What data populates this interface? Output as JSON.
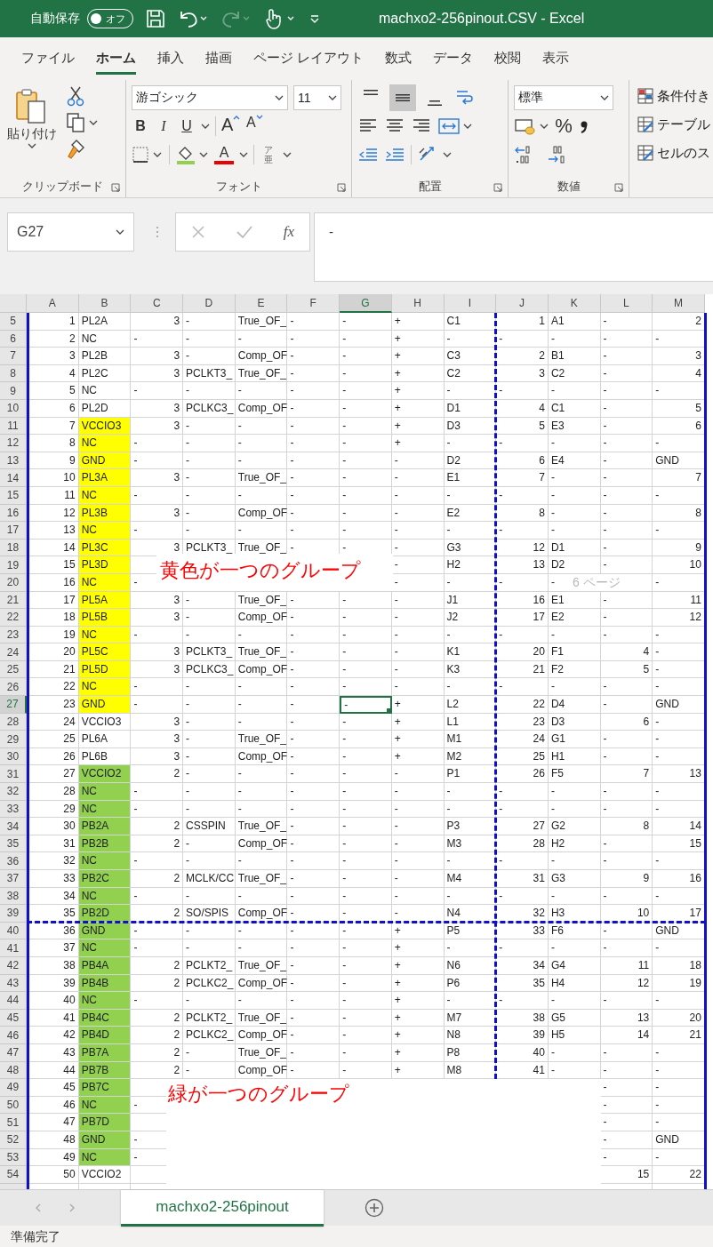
{
  "window": {
    "title": "machxo2-256pinout.CSV  -  Excel",
    "autosave": {
      "label": "自動保存",
      "state_text": "オフ",
      "on": false
    },
    "quick_access": [
      {
        "kind": "save",
        "disabled": false
      },
      {
        "kind": "undo",
        "disabled": false
      },
      {
        "kind": "redo",
        "disabled": true
      },
      {
        "kind": "touch",
        "disabled": false
      },
      {
        "kind": "customize",
        "disabled": false
      }
    ]
  },
  "ribbon_tabs": [
    {
      "label": "ファイル",
      "selected": false
    },
    {
      "label": "ホーム",
      "selected": true
    },
    {
      "label": "挿入",
      "selected": false
    },
    {
      "label": "描画",
      "selected": false
    },
    {
      "label": "ページ レイアウト",
      "selected": false
    },
    {
      "label": "数式",
      "selected": false
    },
    {
      "label": "データ",
      "selected": false
    },
    {
      "label": "校閲",
      "selected": false
    },
    {
      "label": "表示",
      "selected": false
    }
  ],
  "ribbon": {
    "clipboard": {
      "paste": "貼り付け",
      "label": "クリップボード"
    },
    "font": {
      "name": "游ゴシック",
      "size": "11",
      "bold": "B",
      "italic": "I",
      "underline": "U",
      "grow": "A",
      "shrink": "A",
      "font_color": "A",
      "phonetic_top": "ア",
      "phonetic_bottom": "亜",
      "label": "フォント"
    },
    "alignment": {
      "vertical": [
        {
          "kind": "top",
          "selected": false
        },
        {
          "kind": "middle",
          "selected": true
        },
        {
          "kind": "bottom",
          "selected": false
        }
      ],
      "label": "配置"
    },
    "number": {
      "format": "標準",
      "percent": "%",
      "label": "数値"
    },
    "styles": [
      "条件付き",
      "テーブル",
      "セルのス"
    ]
  },
  "formula_bar": {
    "name_box": "G27",
    "fx": "fx",
    "value": "-"
  },
  "sheet": {
    "columns": [
      {
        "label": "A",
        "selected": false
      },
      {
        "label": "B",
        "selected": false
      },
      {
        "label": "C",
        "selected": false
      },
      {
        "label": "D",
        "selected": false
      },
      {
        "label": "E",
        "selected": false
      },
      {
        "label": "F",
        "selected": false
      },
      {
        "label": "G",
        "selected": true
      },
      {
        "label": "H",
        "selected": false
      },
      {
        "label": "I",
        "selected": false
      },
      {
        "label": "J",
        "selected": false
      },
      {
        "label": "K",
        "selected": false
      },
      {
        "label": "L",
        "selected": false
      },
      {
        "label": "M",
        "selected": false
      }
    ],
    "rows": [
      {
        "n": "5",
        "selected": false,
        "cells": [
          "1",
          "PL2A",
          "3",
          "-",
          "True_OF_",
          "-",
          "-",
          "+",
          "C1",
          "1",
          "A1",
          "-",
          "2"
        ]
      },
      {
        "n": "6",
        "selected": false,
        "cells": [
          "2",
          "NC",
          "-",
          "-",
          "-",
          "-",
          "-",
          "+",
          "-",
          "-",
          "-",
          "-",
          "-"
        ]
      },
      {
        "n": "7",
        "selected": false,
        "cells": [
          "3",
          "PL2B",
          "3",
          "-",
          "Comp_OF",
          "-",
          "-",
          "+",
          "C3",
          "2",
          "B1",
          "-",
          "3"
        ]
      },
      {
        "n": "8",
        "selected": false,
        "cells": [
          "4",
          "PL2C",
          "3",
          "PCLKT3_",
          "True_OF_",
          "-",
          "-",
          "+",
          "C2",
          "3",
          "C2",
          "-",
          "4"
        ]
      },
      {
        "n": "9",
        "selected": false,
        "cells": [
          "5",
          "NC",
          "-",
          "-",
          "-",
          "-",
          "-",
          "+",
          "-",
          "-",
          "-",
          "-",
          "-"
        ]
      },
      {
        "n": "10",
        "selected": false,
        "cells": [
          "6",
          "PL2D",
          "3",
          "PCLKC3_",
          "Comp_OF",
          "-",
          "-",
          "+",
          "D1",
          "4",
          "C1",
          "-",
          "5"
        ]
      },
      {
        "n": "11",
        "selected": false,
        "color": "#ffff00",
        "cells": [
          "7",
          "VCCIO3",
          "3",
          "-",
          "-",
          "-",
          "-",
          "+",
          "D3",
          "5",
          "E3",
          "-",
          "6"
        ]
      },
      {
        "n": "12",
        "selected": false,
        "color": "#ffff00",
        "cells": [
          "8",
          "NC",
          "-",
          "-",
          "-",
          "-",
          "-",
          "+",
          "-",
          "-",
          "-",
          "-",
          "-"
        ]
      },
      {
        "n": "13",
        "selected": false,
        "color": "#ffff00",
        "cells": [
          "9",
          "GND",
          "-",
          "-",
          "-",
          "-",
          "-",
          "-",
          "D2",
          "6",
          "E4",
          "-",
          "GND"
        ]
      },
      {
        "n": "14",
        "selected": false,
        "color": "#ffff00",
        "cells": [
          "10",
          "PL3A",
          "3",
          "-",
          "True_OF_",
          "-",
          "-",
          "-",
          "E1",
          "7",
          "-",
          "-",
          "7"
        ]
      },
      {
        "n": "15",
        "selected": false,
        "color": "#ffff00",
        "cells": [
          "11",
          "NC",
          "-",
          "-",
          "-",
          "-",
          "-",
          "-",
          "-",
          "-",
          "-",
          "-",
          "-"
        ]
      },
      {
        "n": "16",
        "selected": false,
        "color": "#ffff00",
        "cells": [
          "12",
          "PL3B",
          "3",
          "-",
          "Comp_OF",
          "-",
          "-",
          "-",
          "E2",
          "8",
          "-",
          "-",
          "8"
        ]
      },
      {
        "n": "17",
        "selected": false,
        "color": "#ffff00",
        "cells": [
          "13",
          "NC",
          "-",
          "-",
          "-",
          "-",
          "-",
          "-",
          "-",
          "-",
          "-",
          "-",
          "-"
        ]
      },
      {
        "n": "18",
        "selected": false,
        "color": "#ffff00",
        "cells": [
          "14",
          "PL3C",
          "3",
          "PCLKT3_",
          "True_OF_",
          "-",
          "-",
          "-",
          "G3",
          "12",
          "D1",
          "-",
          "9"
        ]
      },
      {
        "n": "19",
        "selected": false,
        "color": "#ffff00",
        "cells": [
          "15",
          "PL3D",
          null,
          null,
          null,
          null,
          null,
          "-",
          "H2",
          "13",
          "D2",
          "-",
          "10"
        ]
      },
      {
        "n": "20",
        "selected": false,
        "color": "#ffff00",
        "cells": [
          "16",
          "NC",
          "-",
          null,
          null,
          null,
          null,
          "-",
          "-",
          "-",
          "-",
          null,
          "-"
        ]
      },
      {
        "n": "21",
        "selected": false,
        "color": "#ffff00",
        "cells": [
          "17",
          "PL5A",
          "3",
          "-",
          "True_OF_",
          "-",
          "-",
          "-",
          "J1",
          "16",
          "E1",
          "-",
          "11"
        ]
      },
      {
        "n": "22",
        "selected": false,
        "color": "#ffff00",
        "cells": [
          "18",
          "PL5B",
          "3",
          "-",
          "Comp_OF",
          "-",
          "-",
          "-",
          "J2",
          "17",
          "E2",
          "-",
          "12"
        ]
      },
      {
        "n": "23",
        "selected": false,
        "color": "#ffff00",
        "cells": [
          "19",
          "NC",
          "-",
          "-",
          "-",
          "-",
          "-",
          "-",
          "-",
          "-",
          "-",
          "-",
          "-"
        ]
      },
      {
        "n": "24",
        "selected": false,
        "color": "#ffff00",
        "cells": [
          "20",
          "PL5C",
          "3",
          "PCLKT3_",
          "True_OF_",
          "-",
          "-",
          "-",
          "K1",
          "20",
          "F1",
          "4",
          "-"
        ]
      },
      {
        "n": "25",
        "selected": false,
        "color": "#ffff00",
        "cells": [
          "21",
          "PL5D",
          "3",
          "PCLKC3_",
          "Comp_OF",
          "-",
          "-",
          "-",
          "K3",
          "21",
          "F2",
          "5",
          "-"
        ]
      },
      {
        "n": "26",
        "selected": false,
        "color": "#ffff00",
        "cells": [
          "22",
          "NC",
          "-",
          "-",
          "-",
          "-",
          "-",
          "-",
          "-",
          "-",
          "-",
          "-",
          "-"
        ]
      },
      {
        "n": "27",
        "selected": true,
        "color": "#ffff00",
        "cells": [
          "23",
          "GND",
          "-",
          "-",
          "-",
          "-",
          "-",
          "+",
          "L2",
          "22",
          "D4",
          "-",
          "GND"
        ]
      },
      {
        "n": "28",
        "selected": false,
        "cells": [
          "24",
          "VCCIO3",
          "3",
          "-",
          "-",
          "-",
          "-",
          "+",
          "L1",
          "23",
          "D3",
          "6",
          "-"
        ]
      },
      {
        "n": "29",
        "selected": false,
        "cells": [
          "25",
          "PL6A",
          "3",
          "-",
          "True_OF_",
          "-",
          "-",
          "+",
          "M1",
          "24",
          "G1",
          "-",
          "-"
        ]
      },
      {
        "n": "30",
        "selected": false,
        "cells": [
          "26",
          "PL6B",
          "3",
          "-",
          "Comp_OF",
          "-",
          "-",
          "+",
          "M2",
          "25",
          "H1",
          "-",
          "-"
        ]
      },
      {
        "n": "31",
        "selected": false,
        "color": "#92d050",
        "cells": [
          "27",
          "VCCIO2",
          "2",
          "-",
          "-",
          "-",
          "-",
          "-",
          "P1",
          "26",
          "F5",
          "7",
          "13"
        ]
      },
      {
        "n": "32",
        "selected": false,
        "color": "#92d050",
        "cells": [
          "28",
          "NC",
          "-",
          "-",
          "-",
          "-",
          "-",
          "-",
          "-",
          "-",
          "-",
          "-",
          "-"
        ]
      },
      {
        "n": "33",
        "selected": false,
        "color": "#92d050",
        "cells": [
          "29",
          "NC",
          "-",
          "-",
          "-",
          "-",
          "-",
          "-",
          "-",
          "-",
          "-",
          "-",
          "-"
        ]
      },
      {
        "n": "34",
        "selected": false,
        "color": "#92d050",
        "cells": [
          "30",
          "PB2A",
          "2",
          "CSSPIN",
          "True_OF_",
          "-",
          "-",
          "-",
          "P3",
          "27",
          "G2",
          "8",
          "14"
        ]
      },
      {
        "n": "35",
        "selected": false,
        "color": "#92d050",
        "cells": [
          "31",
          "PB2B",
          "2",
          "-",
          "Comp_OF",
          "-",
          "-",
          "-",
          "M3",
          "28",
          "H2",
          "-",
          "15"
        ]
      },
      {
        "n": "36",
        "selected": false,
        "color": "#92d050",
        "cells": [
          "32",
          "NC",
          "-",
          "-",
          "-",
          "-",
          "-",
          "-",
          "-",
          "-",
          "-",
          "-",
          "-"
        ]
      },
      {
        "n": "37",
        "selected": false,
        "color": "#92d050",
        "cells": [
          "33",
          "PB2C",
          "2",
          "MCLK/CC",
          "True_OF_",
          "-",
          "-",
          "-",
          "M4",
          "31",
          "G3",
          "9",
          "16"
        ]
      },
      {
        "n": "38",
        "selected": false,
        "color": "#92d050",
        "cells": [
          "34",
          "NC",
          "-",
          "-",
          "-",
          "-",
          "-",
          "-",
          "-",
          "-",
          "-",
          "-",
          "-"
        ]
      },
      {
        "n": "39",
        "selected": false,
        "color": "#92d050",
        "cells": [
          "35",
          "PB2D",
          "2",
          "SO/SPIS",
          "Comp_OF",
          "-",
          "-",
          "-",
          "N4",
          "32",
          "H3",
          "10",
          "17"
        ]
      },
      {
        "n": "40",
        "selected": false,
        "color": "#92d050",
        "cells": [
          "36",
          "GND",
          "-",
          "-",
          "-",
          "-",
          "-",
          "+",
          "P5",
          "33",
          "F6",
          "-",
          "GND"
        ]
      },
      {
        "n": "41",
        "selected": false,
        "color": "#92d050",
        "cells": [
          "37",
          "NC",
          "-",
          "-",
          "-",
          "-",
          "-",
          "+",
          "-",
          "-",
          "-",
          "-",
          "-"
        ]
      },
      {
        "n": "42",
        "selected": false,
        "color": "#92d050",
        "cells": [
          "38",
          "PB4A",
          "2",
          "PCLKT2_",
          "True_OF_",
          "-",
          "-",
          "+",
          "N6",
          "34",
          "G4",
          "11",
          "18"
        ]
      },
      {
        "n": "43",
        "selected": false,
        "color": "#92d050",
        "cells": [
          "39",
          "PB4B",
          "2",
          "PCLKC2_",
          "Comp_OF",
          "-",
          "-",
          "+",
          "P6",
          "35",
          "H4",
          "12",
          "19"
        ]
      },
      {
        "n": "44",
        "selected": false,
        "color": "#92d050",
        "cells": [
          "40",
          "NC",
          "-",
          "-",
          "-",
          "-",
          "-",
          "+",
          "-",
          "-",
          "-",
          "-",
          "-"
        ]
      },
      {
        "n": "45",
        "selected": false,
        "color": "#92d050",
        "cells": [
          "41",
          "PB4C",
          "2",
          "PCLKT2_",
          "True_OF_",
          "-",
          "-",
          "+",
          "M7",
          "38",
          "G5",
          "13",
          "20"
        ]
      },
      {
        "n": "46",
        "selected": false,
        "color": "#92d050",
        "cells": [
          "42",
          "PB4D",
          "2",
          "PCLKC2_",
          "Comp_OF",
          "-",
          "-",
          "+",
          "N8",
          "39",
          "H5",
          "14",
          "21"
        ]
      },
      {
        "n": "47",
        "selected": false,
        "color": "#92d050",
        "cells": [
          "43",
          "PB7A",
          "2",
          "-",
          "True_OF_",
          "-",
          "-",
          "+",
          "P8",
          "40",
          "-",
          "-",
          "-"
        ]
      },
      {
        "n": "48",
        "selected": false,
        "color": "#92d050",
        "cells": [
          "44",
          "PB7B",
          "2",
          "-",
          "Comp_OF",
          "-",
          "-",
          "+",
          "M8",
          "41",
          "-",
          "-",
          "-"
        ]
      },
      {
        "n": "49",
        "selected": false,
        "color": "#92d050",
        "cells": [
          "45",
          "PB7C",
          null,
          null,
          null,
          null,
          null,
          null,
          null,
          null,
          null,
          "-",
          "-"
        ]
      },
      {
        "n": "50",
        "selected": false,
        "color": "#92d050",
        "cells": [
          "46",
          "NC",
          "-",
          null,
          null,
          null,
          null,
          null,
          null,
          null,
          null,
          "-",
          "-"
        ]
      },
      {
        "n": "51",
        "selected": false,
        "color": "#92d050",
        "cells": [
          "47",
          "PB7D",
          null,
          null,
          null,
          null,
          null,
          null,
          null,
          null,
          null,
          "-",
          "-"
        ]
      },
      {
        "n": "52",
        "selected": false,
        "color": "#92d050",
        "cells": [
          "48",
          "GND",
          "-",
          null,
          null,
          null,
          null,
          null,
          null,
          null,
          null,
          "-",
          "GND"
        ]
      },
      {
        "n": "53",
        "selected": false,
        "color": "#92d050",
        "cells": [
          "49",
          "NC",
          "-",
          null,
          null,
          null,
          null,
          null,
          null,
          null,
          null,
          "-",
          "-"
        ]
      },
      {
        "n": "54",
        "selected": false,
        "cells": [
          "50",
          "VCCIO2",
          null,
          null,
          null,
          null,
          null,
          null,
          null,
          null,
          null,
          "15",
          "22"
        ]
      }
    ],
    "page_label": "6 ページ",
    "annotations": [
      {
        "text": "黄色が一つのグループ"
      },
      {
        "text": "緑が一つのグループ"
      }
    ]
  },
  "sheet_tabs": [
    {
      "label": "machxo2-256pinout",
      "selected": true
    }
  ],
  "status_bar": {
    "text": "準備完了"
  }
}
